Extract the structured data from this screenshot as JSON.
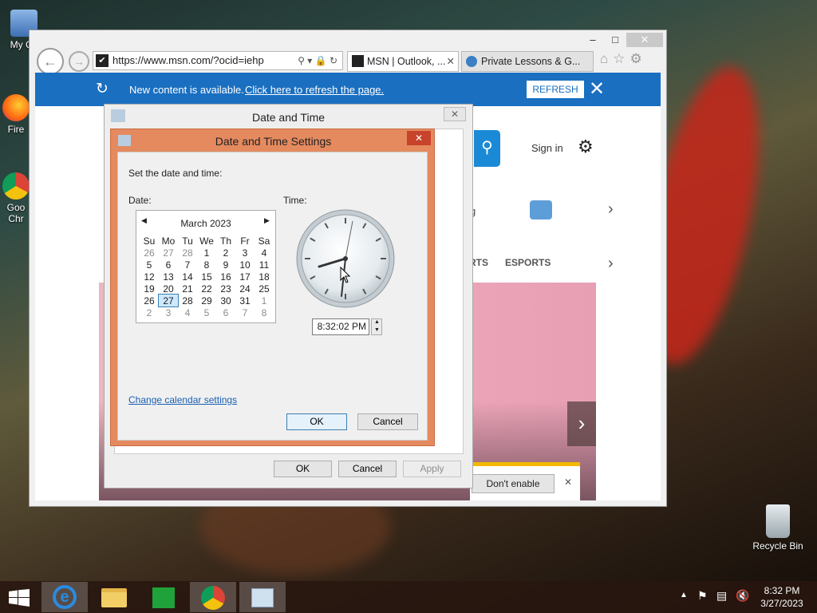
{
  "desktop": {
    "icons": [
      {
        "label": "My Co"
      },
      {
        "label": "Fire"
      },
      {
        "label": "Goo Chr"
      },
      {
        "label": "Recycle Bin"
      }
    ]
  },
  "browser": {
    "url": "https://www.msn.com/?ocid=iehp",
    "tabs": [
      {
        "label": "MSN | Outlook, ..."
      },
      {
        "label": "Private Lessons & G..."
      }
    ],
    "notification": {
      "text": "New content is available.",
      "link": "Click here to refresh the page.",
      "button": "REFRESH"
    },
    "msn": {
      "sign_in": "Sign in",
      "nav_items": [
        "RTS",
        "ESPORTS"
      ],
      "partial_text": "g",
      "partial_e": "e"
    },
    "addon_bar": {
      "dont_enable": "Don't enable"
    }
  },
  "date_time_dialog": {
    "title": "Date and Time",
    "ok": "OK",
    "cancel": "Cancel",
    "apply": "Apply"
  },
  "settings_dialog": {
    "title": "Date and Time Settings",
    "instruction": "Set the date and time:",
    "date_label": "Date:",
    "time_label": "Time:",
    "month": "March 2023",
    "weekdays": [
      "Su",
      "Mo",
      "Tu",
      "We",
      "Th",
      "Fr",
      "Sa"
    ],
    "weeks": [
      [
        "26",
        "27",
        "28",
        "1",
        "2",
        "3",
        "4"
      ],
      [
        "5",
        "6",
        "7",
        "8",
        "9",
        "10",
        "11"
      ],
      [
        "12",
        "13",
        "14",
        "15",
        "16",
        "17",
        "18"
      ],
      [
        "19",
        "20",
        "21",
        "22",
        "23",
        "24",
        "25"
      ],
      [
        "26",
        "27",
        "28",
        "29",
        "30",
        "31",
        "1"
      ],
      [
        "2",
        "3",
        "4",
        "5",
        "6",
        "7",
        "8"
      ]
    ],
    "selected_day": "27",
    "time_value": "8:32:02 PM",
    "change_link": "Change calendar settings",
    "ok": "OK",
    "cancel": "Cancel"
  },
  "taskbar": {
    "time": "8:32 PM",
    "date": "3/27/2023"
  },
  "colors": {
    "notification_blue": "#1a6fc0",
    "dialog_orange": "#e58a5f"
  }
}
